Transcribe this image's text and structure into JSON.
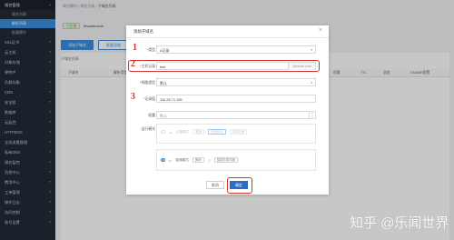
{
  "sidebar": {
    "sections": [
      {
        "label": "域名管理",
        "expanded": true,
        "active": true
      },
      {
        "label": "SSL证书",
        "expanded": false
      },
      {
        "label": "云主机",
        "expanded": false
      },
      {
        "label": "对象存储",
        "expanded": false
      },
      {
        "label": "弹性IP",
        "expanded": false
      },
      {
        "label": "负载均衡",
        "expanded": false
      },
      {
        "label": "CDN",
        "expanded": false
      },
      {
        "label": "安全组",
        "expanded": false
      },
      {
        "label": "数据库",
        "expanded": false
      },
      {
        "label": "云监控",
        "expanded": false
      },
      {
        "label": "HTTPDNS",
        "expanded": false
      },
      {
        "label": "全局流量管理",
        "expanded": false
      },
      {
        "label": "私有DNS",
        "expanded": false
      },
      {
        "label": "域名监控",
        "expanded": false
      },
      {
        "label": "消息中心",
        "expanded": false
      },
      {
        "label": "费用中心",
        "expanded": false
      },
      {
        "label": "工单管理",
        "expanded": false
      },
      {
        "label": "操作日志",
        "expanded": false
      },
      {
        "label": "访问控制",
        "expanded": false
      },
      {
        "label": "账号设置",
        "expanded": false
      }
    ],
    "sub_items": [
      {
        "label": "域名列表",
        "active": false
      },
      {
        "label": "解析列表",
        "active": true
      },
      {
        "label": "批量操作",
        "active": false
      }
    ]
  },
  "page": {
    "breadcrumb": [
      "域名解析",
      "域名列表",
      "子域名列表"
    ],
    "tag": "已生效",
    "domain": "lbvante.com",
    "add_button": "添加子域名",
    "batch_button": "批量添加",
    "list_label": "子域名列表",
    "columns": [
      "子域名",
      "解析类型",
      "线路类型",
      "记录值",
      "权重",
      "TTL",
      "状态",
      "CNAME配置"
    ]
  },
  "modal": {
    "title": "添加子域名",
    "close": "×",
    "fields": {
      "type": {
        "label": "类型",
        "value": "A记录",
        "marker": "1"
      },
      "subdomain": {
        "label": "主机记录",
        "value": "test",
        "suffix": ".lbvante.com",
        "marker": "2"
      },
      "line": {
        "label": "线路类型",
        "value": "默认"
      },
      "record": {
        "label": "记录值",
        "value": "116.28.71.155",
        "marker": "3"
      },
      "weight": {
        "label": "权重",
        "value": "默认"
      },
      "mode": {
        "label": "运行模式"
      }
    },
    "mode_option_1": {
      "title": "云端模式",
      "chips": [
        "普通",
        "加速优化",
        "高防加速"
      ]
    },
    "mode_option_2": {
      "title": "普通模式",
      "chips": [
        "解析",
        "智能负载均衡"
      ]
    },
    "cancel": "取消",
    "ok": "确定"
  },
  "watermark": "知乎 @乐闻世界",
  "colors": {
    "accent": "#3c8dde",
    "sidebar": "#232b38",
    "annotation": "#d2322d"
  }
}
